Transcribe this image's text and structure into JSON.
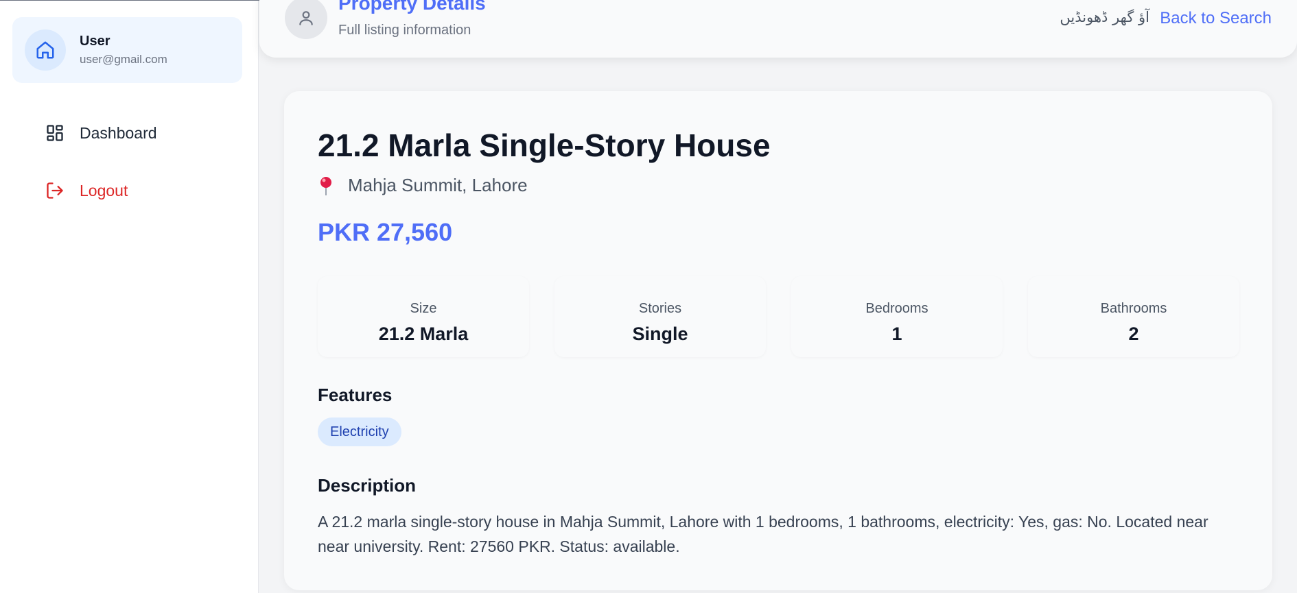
{
  "sidebar": {
    "user": {
      "name": "User",
      "email": "user@gmail.com"
    },
    "items": [
      {
        "label": "Dashboard",
        "icon": "dashboard-grid-icon"
      },
      {
        "label": "Logout",
        "icon": "logout-icon"
      }
    ]
  },
  "header": {
    "title": "Property Details",
    "subtitle": "Full listing information",
    "urdu_tagline": "آؤ گھر ڈھونڈیں",
    "back_link": "Back to Search"
  },
  "property": {
    "title": "21.2 Marla Single-Story House",
    "location": "Mahja Summit, Lahore",
    "price": "PKR 27,560",
    "stats": [
      {
        "label": "Size",
        "value": "21.2 Marla"
      },
      {
        "label": "Stories",
        "value": "Single"
      },
      {
        "label": "Bedrooms",
        "value": "1"
      },
      {
        "label": "Bathrooms",
        "value": "2"
      }
    ],
    "features_heading": "Features",
    "features": [
      "Electricity"
    ],
    "description_heading": "Description",
    "description": "A 21.2 marla single-story house in Mahja Summit, Lahore with 1 bedrooms, 1 bathrooms, electricity: Yes, gas: No. Located near near university. Rent: 27560 PKR. Status: available."
  },
  "colors": {
    "accent": "#4f6ef7",
    "danger": "#dc2626",
    "chip_bg": "#dbeafe",
    "sidebar_highlight": "#eff6ff"
  }
}
